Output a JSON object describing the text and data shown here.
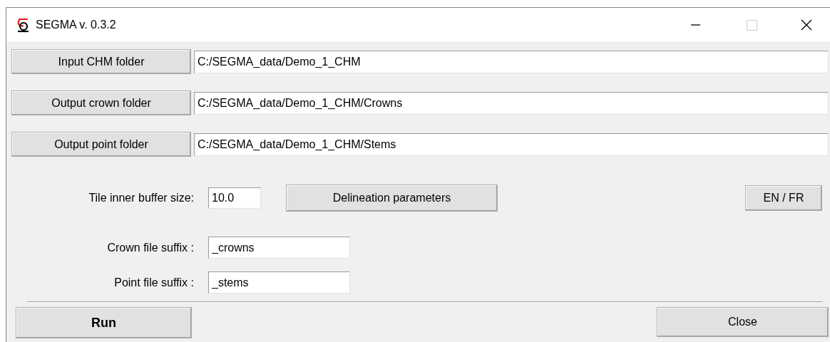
{
  "window": {
    "title": "SEGMA v. 0.3.2"
  },
  "folder_rows": [
    {
      "button": "Input CHM folder",
      "path": "C:/SEGMA_data/Demo_1_CHM"
    },
    {
      "button": "Output crown folder",
      "path": "C:/SEGMA_data/Demo_1_CHM/Crowns"
    },
    {
      "button": "Output point folder",
      "path": "C:/SEGMA_data/Demo_1_CHM/Stems"
    }
  ],
  "buffer": {
    "label": "Tile inner buffer size:",
    "value": "10.0"
  },
  "delineation_button": "Delineation parameters",
  "language_button": "EN / FR",
  "suffixes": [
    {
      "label": "Crown file suffix :",
      "value": "_crowns"
    },
    {
      "label": "Point file suffix :",
      "value": "_stems"
    }
  ],
  "run_button": "Run",
  "close_button": "Close"
}
